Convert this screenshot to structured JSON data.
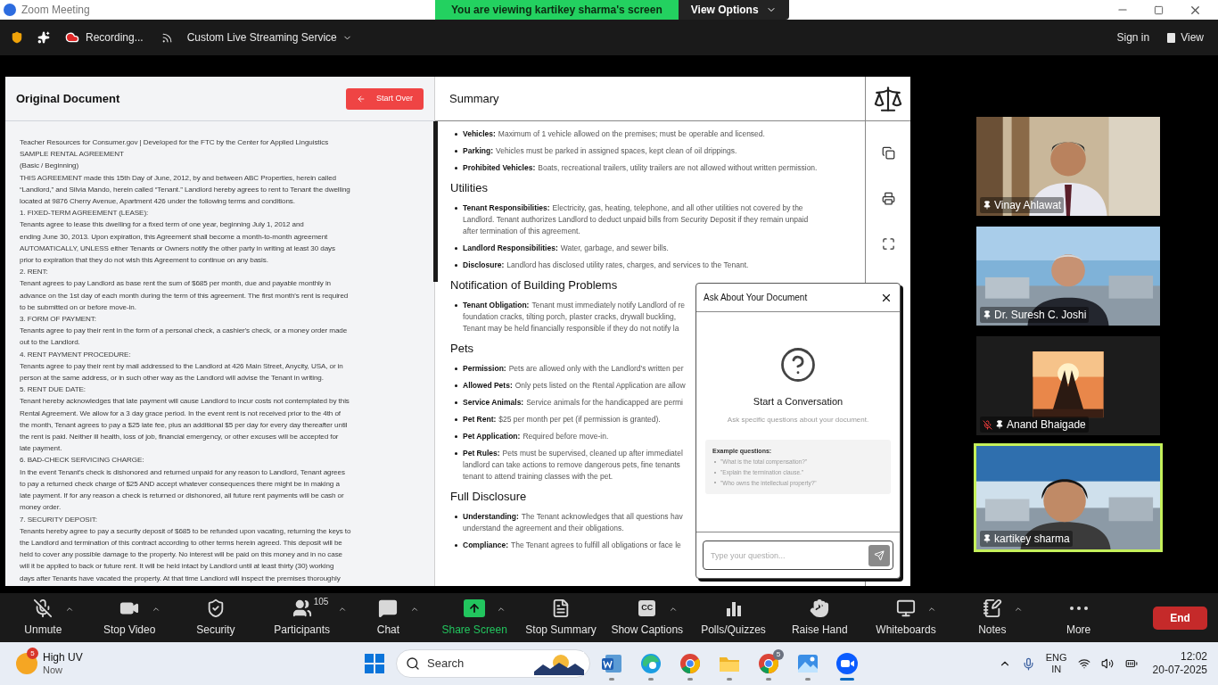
{
  "window": {
    "title": "Zoom Meeting"
  },
  "banner": {
    "text": "You are viewing kartikey sharma's screen",
    "options": "View Options"
  },
  "meeting_bar": {
    "recording": "Recording...",
    "streaming": "Custom Live Streaming Service",
    "sign_in": "Sign in",
    "view": "View"
  },
  "document": {
    "title": "Original Document",
    "start_over": "Start Over",
    "lines": [
      "Teacher Resources for Consumer.gov | Developed for the FTC by the Center for Applied Linguistics",
      "SAMPLE RENTAL AGREEMENT",
      "(Basic / Beginning)",
      "THIS AGREEMENT made this 15th Day of June, 2012, by and between ABC Properties, herein called",
      "“Landlord,” and Silvia Mando, herein called “Tenant.” Landlord hereby agrees to rent to Tenant the dwelling",
      "located at 9876 Cherry Avenue, Apartment 426 under the following terms and conditions.",
      "1. FIXED-TERM AGREEMENT (LEASE):",
      "Tenants agree to lease this dwelling for a fixed term of one year, beginning July 1, 2012 and",
      "ending June 30, 2013. Upon expiration, this Agreement shall become a month-to-month agreement",
      "AUTOMATICALLY, UNLESS either Tenants or Owners notify the other party in writing at least 30 days",
      "prior to expiration that they do not wish this Agreement to continue on any basis.",
      "2. RENT:",
      "Tenant agrees to pay Landlord as base rent the sum of $685 per month, due and payable monthly in",
      "advance on the 1st day of each month during the term of this agreement. The first month's rent is required",
      "to be submitted on or before move-in.",
      "3. FORM OF PAYMENT:",
      "Tenants agree to pay their rent in the form of a personal check, a cashier's check, or a money order made",
      "out to the Landlord.",
      "4. RENT PAYMENT PROCEDURE:",
      "Tenants agree to pay their rent by mail addressed to the Landlord at 426 Main Street, Anycity, USA, or in",
      "person at the same address, or in such other way as the Landlord will advise the Tenant in writing.",
      "5. RENT DUE DATE:",
      "Tenant hereby acknowledges that late payment will cause Landlord to incur costs not contemplated by this",
      "Rental Agreement. We allow for a 3 day grace period. In the event rent is not received prior to the 4th of",
      "the month, Tenant agrees to pay a $25 late fee, plus an additional $5 per day for every day thereafter until",
      "the rent is paid. Neither ill health, loss of job, financial emergency, or other excuses will be accepted for",
      "late payment.",
      "6. BAD-CHECK SERVICING CHARGE:",
      "In the event Tenant's check is dishonored and returned unpaid for any reason to Landlord, Tenant agrees",
      "to pay a returned check charge of $25 AND accept whatever consequences there might be in making a",
      "late payment. If for any reason a check is returned or dishonored, all future rent payments will be cash or",
      "money order.",
      "7. SECURITY DEPOSIT:",
      "Tenants hereby agree to pay a security deposit of $685 to be refunded upon vacating, returning the keys to",
      "the Landlord and termination of this contract according to other terms herein agreed. This deposit will be",
      "held to cover any possible damage to the property. No interest will be paid on this money and in no case",
      "will it be applied to back or future rent. It will be held intact by Landlord until at least thirty (30) working",
      "days after Tenants have vacated the property. At that time Landlord will inspect the premises thoroughly"
    ]
  },
  "summary": {
    "title": "Summary",
    "sections": [
      {
        "items": [
          {
            "label": "Vehicles:",
            "lines": [
              "Maximum of 1 vehicle allowed on the premises; must be operable and licensed."
            ]
          },
          {
            "label": "Parking:",
            "lines": [
              "Vehicles must be parked in assigned spaces, kept clean of oil drippings."
            ]
          },
          {
            "label": "Prohibited Vehicles:",
            "lines": [
              "Boats, recreational trailers, utility trailers are not allowed without written permission."
            ]
          }
        ]
      },
      {
        "heading": "Utilities",
        "items": [
          {
            "label": "Tenant Responsibilities:",
            "lines": [
              "Electricity, gas, heating, telephone, and all other utilities not covered by the",
              "Landlord. Tenant authorizes Landlord to deduct unpaid bills from Security Deposit if they remain unpaid",
              "after termination of this agreement."
            ]
          },
          {
            "label": "Landlord Responsibilities:",
            "lines": [
              "Water, garbage, and sewer bills."
            ]
          },
          {
            "label": "Disclosure:",
            "lines": [
              "Landlord has disclosed utility rates, charges, and services to the Tenant."
            ]
          }
        ]
      },
      {
        "heading": "Notification of Building Problems",
        "items": [
          {
            "label": "Tenant Obligation:",
            "lines": [
              "Tenant must immediately notify Landlord of re",
              "foundation cracks, tilting porch, plaster cracks, drywall buckling,",
              "Tenant may be held financially responsible if they do not notify la"
            ]
          }
        ]
      },
      {
        "heading": "Pets",
        "items": [
          {
            "label": "Permission:",
            "lines": [
              "Pets are allowed only with the Landlord's written per"
            ]
          },
          {
            "label": "Allowed Pets:",
            "lines": [
              "Only pets listed on the Rental Application are allow"
            ]
          },
          {
            "label": "Service Animals:",
            "lines": [
              "Service animals for the handicapped are permi"
            ]
          },
          {
            "label": "Pet Rent:",
            "lines": [
              "$25 per month per pet (if permission is granted)."
            ]
          },
          {
            "label": "Pet Application:",
            "lines": [
              "Required before move-in."
            ]
          },
          {
            "label": "Pet Rules:",
            "lines": [
              "Pets must be supervised, cleaned up after immediatel",
              "landlord can take actions to remove dangerous pets, fine tenants",
              "tenant to attend training classes with the pet."
            ]
          }
        ]
      },
      {
        "heading": "Full Disclosure",
        "items": [
          {
            "label": "Understanding:",
            "lines": [
              "The Tenant acknowledges that all questions hav",
              "understand the agreement and their obligations."
            ]
          },
          {
            "label": "Compliance:",
            "lines": [
              "The Tenant agrees to fulfill all obligations or face le"
            ]
          }
        ]
      }
    ]
  },
  "chat": {
    "title": "Ask About Your Document",
    "heading": "Start a Conversation",
    "subtitle": "Ask specific questions about your document.",
    "examples_title": "Example questions:",
    "examples": [
      "\"What is the total compensation?\"",
      "\"Explain the termination clause.\"",
      "\"Who owns the intellectual property?\""
    ],
    "placeholder": "Type your question..."
  },
  "participants": [
    {
      "name": "Vinay Ahlawat",
      "muted": false,
      "speaking": false
    },
    {
      "name": "Dr. Suresh C. Joshi",
      "muted": false,
      "speaking": false
    },
    {
      "name": "Anand Bhaigade",
      "muted": true,
      "speaking": false
    },
    {
      "name": "kartikey sharma",
      "muted": false,
      "speaking": true
    }
  ],
  "toolbar": [
    {
      "kind": "mic",
      "label": "Unmute",
      "caret": true
    },
    {
      "kind": "video",
      "label": "Stop Video",
      "caret": true
    },
    {
      "kind": "security",
      "label": "Security",
      "caret": false
    },
    {
      "kind": "participants",
      "label": "Participants",
      "count": "105",
      "caret": true
    },
    {
      "kind": "chat",
      "label": "Chat",
      "caret": true
    },
    {
      "kind": "share",
      "label": "Share Screen",
      "caret": true,
      "active": true
    },
    {
      "kind": "summary",
      "label": "Stop Summary",
      "caret": false
    },
    {
      "kind": "captions",
      "label": "Show Captions",
      "icon_text": "CC",
      "caret": true
    },
    {
      "kind": "polls",
      "label": "Polls/Quizzes",
      "caret": false
    },
    {
      "kind": "hand",
      "label": "Raise Hand",
      "caret": false
    },
    {
      "kind": "whiteboard",
      "label": "Whiteboards",
      "caret": true
    },
    {
      "kind": "notes",
      "label": "Notes",
      "caret": true
    },
    {
      "kind": "more",
      "label": "More",
      "caret": false
    }
  ],
  "end_button": "End",
  "taskbar": {
    "weather": {
      "title": "High UV",
      "subtitle": "Now",
      "badge": "5"
    },
    "search": "Search",
    "apps": [
      {
        "kind": "word",
        "active": false
      },
      {
        "kind": "edge",
        "active": false
      },
      {
        "kind": "chrome",
        "active": false
      },
      {
        "kind": "files",
        "active": false
      },
      {
        "kind": "chrome",
        "badge": "5",
        "active": false
      },
      {
        "kind": "photos",
        "active": false
      },
      {
        "kind": "zoom",
        "active": true
      }
    ],
    "language": "ENG",
    "region": "IN",
    "time": "12:02",
    "date": "20-07-2025"
  }
}
